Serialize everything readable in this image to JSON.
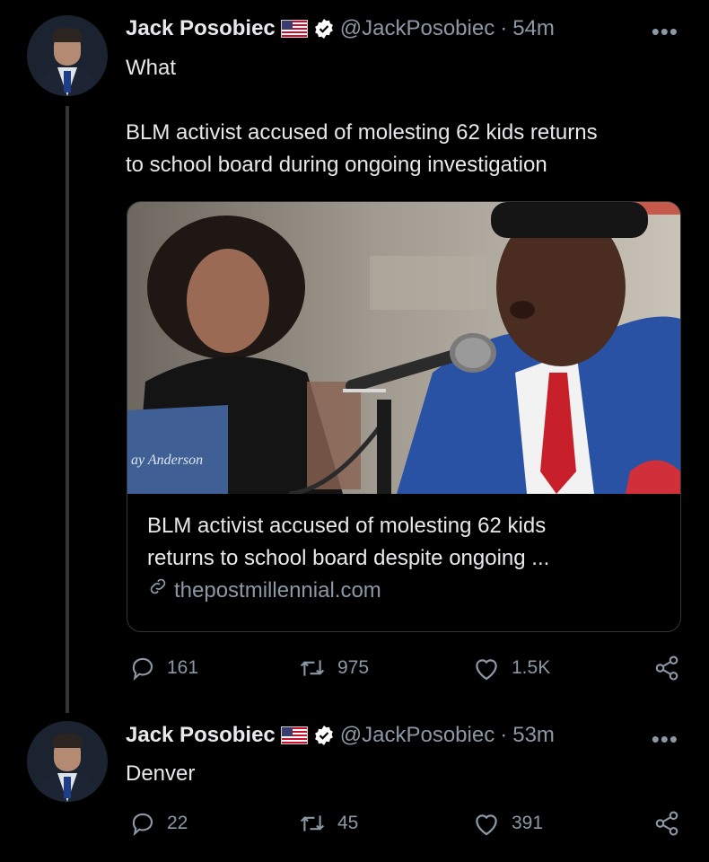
{
  "tweets": [
    {
      "author": {
        "name": "Jack Posobiec",
        "handle": "@JackPosobiec",
        "flag": "us-flag-icon"
      },
      "separator": "·",
      "time": "54m",
      "more": "•••",
      "text_lines": [
        "What",
        "",
        "BLM activist accused of molesting 62 kids returns",
        "to school board during ongoing investigation"
      ],
      "card": {
        "image_name_plate": "ay Anderson",
        "title_lines": [
          "BLM activist accused of molesting 62 kids",
          "returns to school board despite ongoing ..."
        ],
        "domain": "thepostmillennial.com"
      },
      "stats": {
        "replies": "161",
        "retweets": "975",
        "likes": "1.5K"
      }
    },
    {
      "author": {
        "name": "Jack Posobiec",
        "handle": "@JackPosobiec",
        "flag": "us-flag-icon"
      },
      "separator": "·",
      "time": "53m",
      "more": "•••",
      "text_lines": [
        "Denver"
      ],
      "stats": {
        "replies": "22",
        "retweets": "45",
        "likes": "391"
      }
    }
  ],
  "colors": {
    "background": "#000000",
    "text": "#e7e9ea",
    "secondary": "#8b98a5",
    "border": "#333639",
    "verified": "#ffffff"
  }
}
